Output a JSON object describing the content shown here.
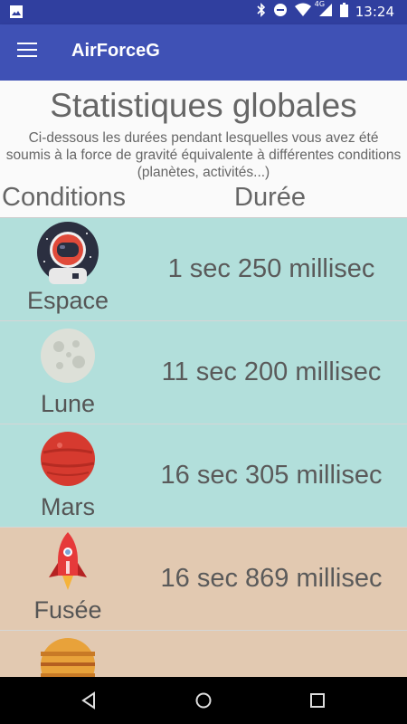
{
  "status_bar": {
    "time": "13:24",
    "network": "4G",
    "icons": [
      "image-icon",
      "bluetooth-icon",
      "do-not-disturb-icon",
      "wifi-icon",
      "cell-signal-icon",
      "battery-icon"
    ]
  },
  "app_bar": {
    "title": "AirForceG",
    "menu_icon": "hamburger-menu-icon"
  },
  "main": {
    "heading": "Statistiques globales",
    "description": "Ci-dessous les durées pendant lesquelles vous avez été soumis à la force de gravité équivalente à différentes conditions (planètes, activités...)",
    "columns": [
      "Conditions",
      "Durée"
    ],
    "rows": [
      {
        "name": "Espace",
        "duration": "1 sec 250 millisec",
        "icon": "astronaut-icon",
        "bg": "#b2dfdb"
      },
      {
        "name": "Lune",
        "duration": "11 sec 200 millisec",
        "icon": "moon-icon",
        "bg": "#b2dfdb"
      },
      {
        "name": "Mars",
        "duration": "16 sec 305 millisec",
        "icon": "mars-icon",
        "bg": "#b2dfdb"
      },
      {
        "name": "Fusée",
        "duration": "16 sec 869 millisec",
        "icon": "rocket-icon",
        "bg": "#e2c9b1"
      },
      {
        "name": "",
        "duration": "",
        "icon": "jupiter-icon",
        "bg": "#e2c9b1"
      }
    ]
  },
  "nav_bar": {
    "buttons": [
      "back-icon",
      "home-icon",
      "recents-icon"
    ]
  },
  "colors": {
    "status_bar": "#303f9f",
    "app_bar": "#3f51b5",
    "row_teal": "#b2dfdb",
    "row_tan": "#e2c9b1"
  }
}
